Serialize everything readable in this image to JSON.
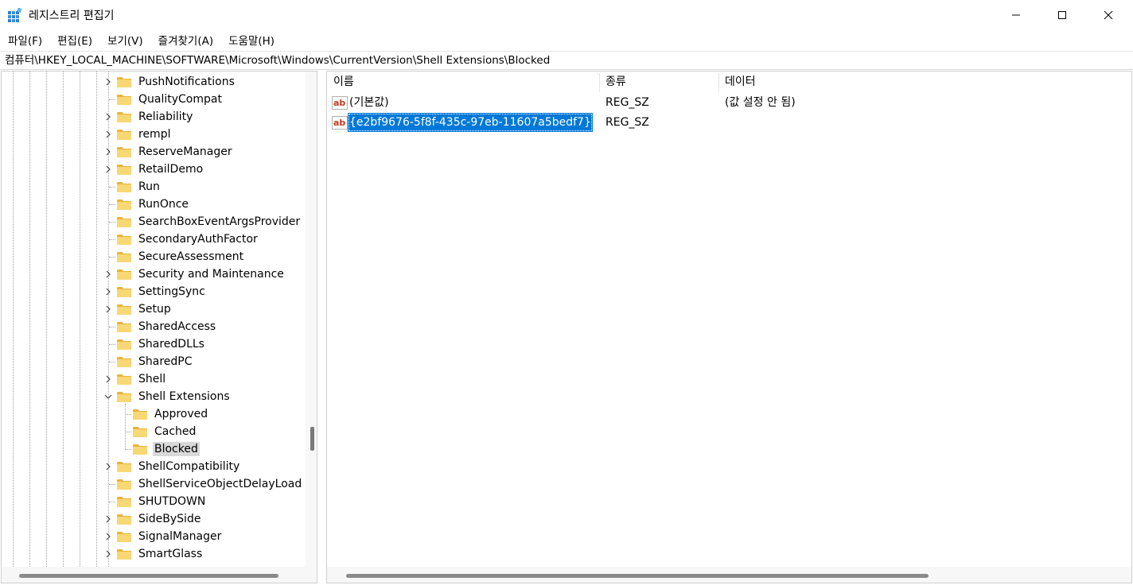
{
  "window": {
    "title": "레지스트리 편집기"
  },
  "menu": [
    "파일(F)",
    "편집(E)",
    "보기(V)",
    "즐겨찾기(A)",
    "도움말(H)"
  ],
  "address": "컴퓨터\\HKEY_LOCAL_MACHINE\\SOFTWARE\\Microsoft\\Windows\\CurrentVersion\\Shell Extensions\\Blocked",
  "tree": {
    "items": [
      {
        "label": "PushNotifications",
        "expandable": true
      },
      {
        "label": "QualityCompat",
        "expandable": false
      },
      {
        "label": "Reliability",
        "expandable": true
      },
      {
        "label": "rempl",
        "expandable": true
      },
      {
        "label": "ReserveManager",
        "expandable": true
      },
      {
        "label": "RetailDemo",
        "expandable": true
      },
      {
        "label": "Run",
        "expandable": false
      },
      {
        "label": "RunOnce",
        "expandable": false
      },
      {
        "label": "SearchBoxEventArgsProvider",
        "expandable": false
      },
      {
        "label": "SecondaryAuthFactor",
        "expandable": false
      },
      {
        "label": "SecureAssessment",
        "expandable": false
      },
      {
        "label": "Security and Maintenance",
        "expandable": true
      },
      {
        "label": "SettingSync",
        "expandable": true
      },
      {
        "label": "Setup",
        "expandable": true
      },
      {
        "label": "SharedAccess",
        "expandable": false
      },
      {
        "label": "SharedDLLs",
        "expandable": false
      },
      {
        "label": "SharedPC",
        "expandable": false
      },
      {
        "label": "Shell",
        "expandable": true
      },
      {
        "label": "Shell Extensions",
        "expandable": true,
        "expanded": true
      },
      {
        "label": "Approved",
        "expandable": false,
        "child": true
      },
      {
        "label": "Cached",
        "expandable": false,
        "child": true
      },
      {
        "label": "Blocked",
        "expandable": false,
        "child": true,
        "selected": true
      },
      {
        "label": "ShellCompatibility",
        "expandable": true
      },
      {
        "label": "ShellServiceObjectDelayLoad",
        "expandable": false
      },
      {
        "label": "SHUTDOWN",
        "expandable": false
      },
      {
        "label": "SideBySide",
        "expandable": true
      },
      {
        "label": "SignalManager",
        "expandable": true
      },
      {
        "label": "SmartGlass",
        "expandable": true
      }
    ]
  },
  "list": {
    "columns": [
      "이름",
      "종류",
      "데이터"
    ],
    "rows": [
      {
        "name": "(기본값)",
        "type": "REG_SZ",
        "data": "(값 설정 안 됨)",
        "selected": false
      },
      {
        "name": "{e2bf9676-5f8f-435c-97eb-11607a5bedf7}",
        "type": "REG_SZ",
        "data": "",
        "selected": true
      }
    ]
  },
  "colors": {
    "selection": "#0078d7",
    "folder": "#f8d775",
    "folder_dark": "#e8b43a",
    "reg_icon_red": "#c23b22"
  },
  "icons": {
    "app": "registry-editor-icon",
    "folder": "folder-icon",
    "value": "reg-string-value-icon"
  }
}
